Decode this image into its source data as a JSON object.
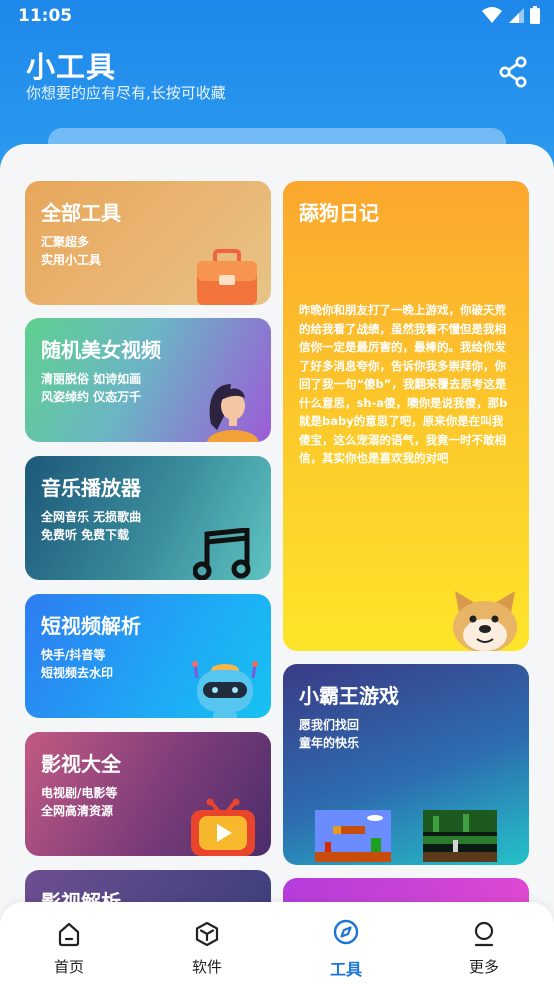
{
  "status": {
    "time": "11:05"
  },
  "header": {
    "title": "小工具",
    "subtitle": "你想要的应有尽有,长按可收藏"
  },
  "cards": {
    "all": {
      "title": "全部工具",
      "desc": "汇聚超多\n实用小工具"
    },
    "girl": {
      "title": "随机美女视频",
      "desc": "清丽脱俗 如诗如画\n风姿绰约 仪态万千"
    },
    "music": {
      "title": "音乐播放器",
      "desc": "全网音乐 无损歌曲\n免费听 免费下载"
    },
    "short": {
      "title": "短视频解析",
      "desc": "快手/抖音等\n短视频去水印"
    },
    "movie": {
      "title": "影视大全",
      "desc": "电视剧/电影等\n全网高清资源"
    },
    "parse": {
      "title": "影视解析"
    },
    "dog": {
      "title": "舔狗日记",
      "desc": "昨晚你和朋友打了一晚上游戏，你破天荒的给我看了战绩，虽然我看不懂但是我相信你一定是最厉害的，最棒的。我给你发了好多消息夸你，告诉你我多崇拜你，你回了我一句“傻b”，我翻来覆去思考这是什么意思，sh-a傻，噢你是说我傻，那b就是baby的意思了吧，原来你是在叫我傻宝，这么宠溺的语气，我竟一时不敢相信，其实你也是喜欢我的对吧"
    },
    "nes": {
      "title": "小霸王游戏",
      "desc": "愿我们找回\n童年的快乐"
    }
  },
  "tabs": [
    {
      "label": "首页",
      "icon": "home-icon"
    },
    {
      "label": "软件",
      "icon": "cube-icon"
    },
    {
      "label": "工具",
      "icon": "compass-icon"
    },
    {
      "label": "更多",
      "icon": "person-icon"
    }
  ],
  "colors": {
    "primary": "#1e88ea",
    "active_tab": "#1c74d9"
  }
}
